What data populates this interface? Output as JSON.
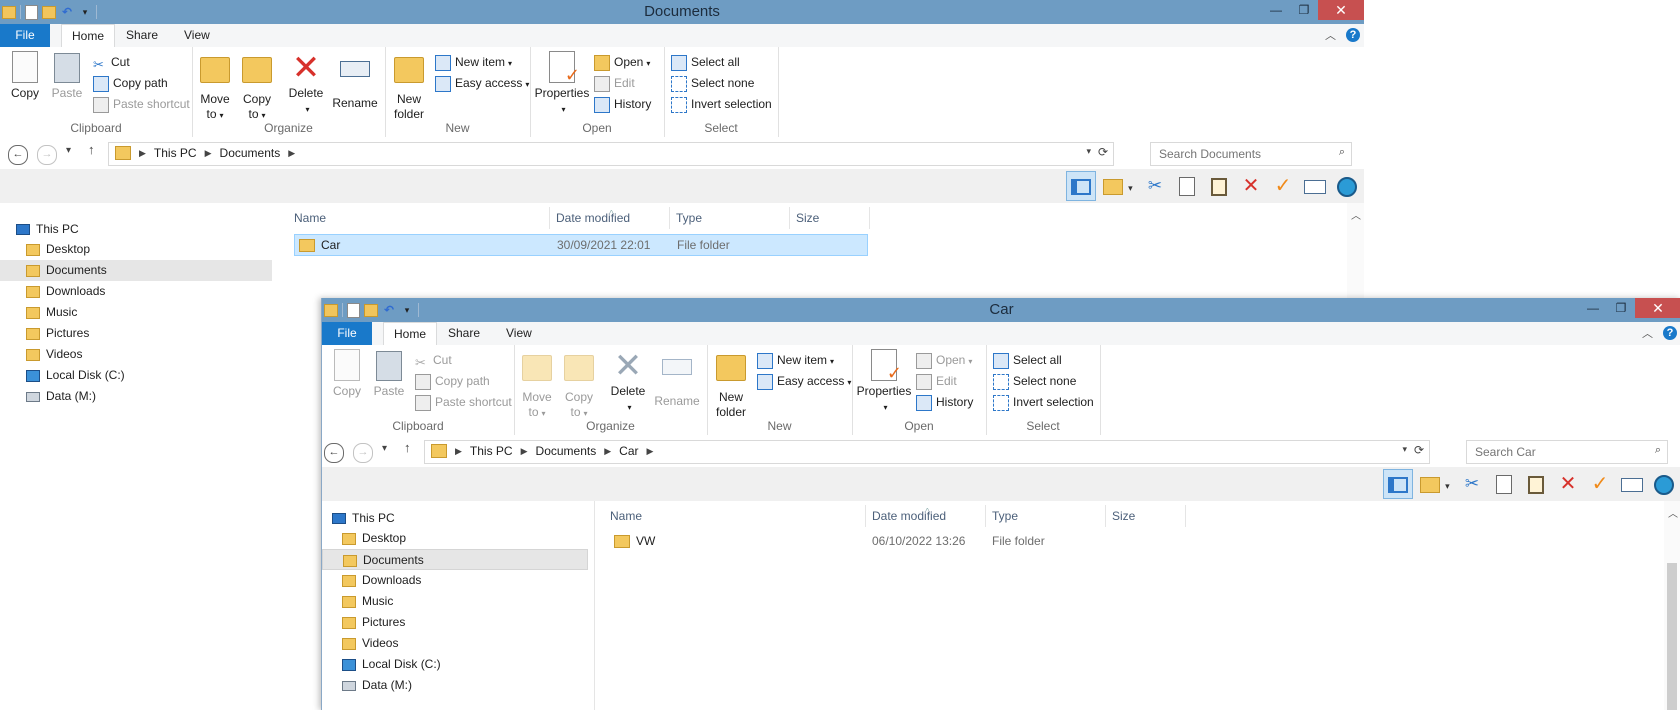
{
  "colors": {
    "titlebar": "#6e9cc3",
    "file_tab": "#1979ca",
    "close_button": "#c75050",
    "selected_row": "#cce8ff",
    "folder": "#f3c85e"
  },
  "ribbon_labels": {
    "tabs": [
      "File",
      "Home",
      "Share",
      "View"
    ],
    "clipboard": {
      "copy": "Copy",
      "paste": "Paste",
      "cut": "Cut",
      "copy_path": "Copy path",
      "paste_shortcut": "Paste shortcut",
      "group": "Clipboard"
    },
    "organize": {
      "move_to_1": "Move",
      "move_to_2": "to",
      "copy_to_1": "Copy",
      "copy_to_2": "to",
      "delete": "Delete",
      "rename": "Rename",
      "group": "Organize"
    },
    "new": {
      "new_folder_1": "New",
      "new_folder_2": "folder",
      "new_item": "New item",
      "easy_access": "Easy access",
      "group": "New"
    },
    "open": {
      "properties": "Properties",
      "open": "Open",
      "edit": "Edit",
      "history": "History",
      "group": "Open"
    },
    "select": {
      "select_all": "Select all",
      "select_none": "Select none",
      "invert": "Invert selection",
      "group": "Select"
    }
  },
  "columns": {
    "name": "Name",
    "date": "Date modified",
    "type": "Type",
    "size": "Size"
  },
  "nav_items": [
    "This PC",
    "Desktop",
    "Documents",
    "Downloads",
    "Music",
    "Pictures",
    "Videos",
    "Local Disk (C:)",
    "Data (M:)"
  ],
  "window1": {
    "title": "Documents",
    "breadcrumbs": [
      "This PC",
      "Documents"
    ],
    "search_placeholder": "Search Documents",
    "files": [
      {
        "name": "Car",
        "date": "30/09/2021 22:01",
        "type": "File folder",
        "size": ""
      }
    ]
  },
  "window2": {
    "title": "Car",
    "breadcrumbs": [
      "This PC",
      "Documents",
      "Car"
    ],
    "search_placeholder": "Search Car",
    "files": [
      {
        "name": "VW",
        "date": "06/10/2022 13:26",
        "type": "File folder",
        "size": ""
      }
    ]
  }
}
